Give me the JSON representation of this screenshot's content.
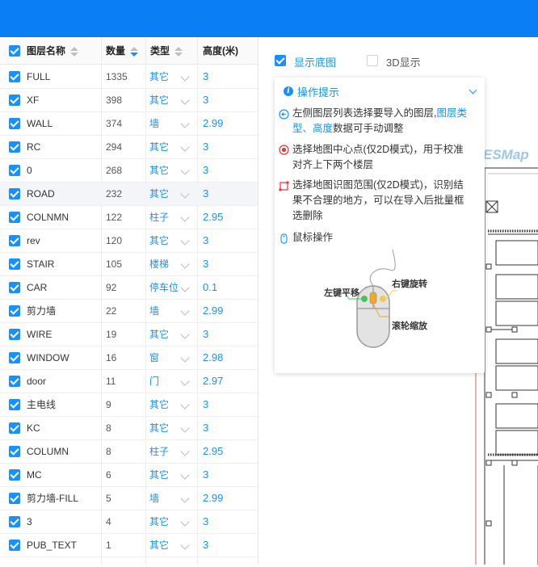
{
  "columns": {
    "name": "图层名称",
    "count": "数量",
    "type": "类型",
    "height": "高度(米)"
  },
  "rows": [
    {
      "name": "FULL",
      "count": "1335",
      "type": "其它",
      "height": "3"
    },
    {
      "name": "XF",
      "count": "398",
      "type": "其它",
      "height": "3"
    },
    {
      "name": "WALL",
      "count": "374",
      "type": "墙",
      "height": "2.99"
    },
    {
      "name": "RC",
      "count": "294",
      "type": "其它",
      "height": "3"
    },
    {
      "name": "0",
      "count": "268",
      "type": "其它",
      "height": "3"
    },
    {
      "name": "ROAD",
      "count": "232",
      "type": "其它",
      "height": "3"
    },
    {
      "name": "COLNMN",
      "count": "122",
      "type": "柱子",
      "height": "2.95"
    },
    {
      "name": "rev",
      "count": "120",
      "type": "其它",
      "height": "3"
    },
    {
      "name": "STAIR",
      "count": "105",
      "type": "楼梯",
      "height": "3"
    },
    {
      "name": "CAR",
      "count": "92",
      "type": "停车位",
      "height": "0.1"
    },
    {
      "name": "剪力墙",
      "count": "22",
      "type": "墙",
      "height": "2.99"
    },
    {
      "name": "WIRE",
      "count": "19",
      "type": "其它",
      "height": "3"
    },
    {
      "name": "WINDOW",
      "count": "16",
      "type": "窗",
      "height": "2.98"
    },
    {
      "name": "door",
      "count": "11",
      "type": "门",
      "height": "2.97"
    },
    {
      "name": "主电线",
      "count": "9",
      "type": "其它",
      "height": "3"
    },
    {
      "name": "KC",
      "count": "8",
      "type": "其它",
      "height": "3"
    },
    {
      "name": "COLUMN",
      "count": "8",
      "type": "柱子",
      "height": "2.95"
    },
    {
      "name": "MC",
      "count": "6",
      "type": "其它",
      "height": "3"
    },
    {
      "name": "剪力墙-FILL",
      "count": "5",
      "type": "墙",
      "height": "2.99"
    },
    {
      "name": "3",
      "count": "4",
      "type": "其它",
      "height": "3"
    },
    {
      "name": "PUB_TEXT",
      "count": "1",
      "type": "其它",
      "height": "3"
    }
  ],
  "toolbar": {
    "show_basemap": "显示底图",
    "show_3d": "3D显示"
  },
  "map": {
    "watermark": "ESMap"
  },
  "tips": {
    "title": "操作提示",
    "tip1_a": "左侧图层列表选择要导入的图层,",
    "tip1_link1": "图层类",
    "tip1_link2": "型",
    "tip1_sep": "、",
    "tip1_link3": "高度",
    "tip1_b": "数据可手动调整",
    "tip2_l1": "选择地图中心点(仅2D模式)，用于校准",
    "tip2_l2": "对齐上下两个楼层",
    "tip3_l1": "选择地图识图范围(仅2D模式)，识别结",
    "tip3_l2": "果不合理的地方，可以在导入后批量框",
    "tip3_l3": "选删除",
    "tip4": "鼠标操作",
    "mouse_left": "左键平移",
    "mouse_right": "右键旋转",
    "mouse_wheel": "滚轮缩放"
  },
  "colors": {
    "accent": "#1890ff",
    "topbar": "#0a7ff5"
  }
}
